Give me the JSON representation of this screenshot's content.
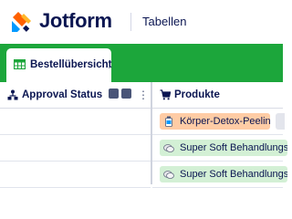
{
  "header": {
    "logo_text": "Jotform",
    "app_label": "Tabellen",
    "logo_colors": [
      "#ff6100",
      "#0099ff",
      "#ffb629",
      "#0a1551"
    ]
  },
  "tab": {
    "label": "Bestellübersicht",
    "more_icon": "⋮",
    "icon": "table-grid-icon",
    "color": "#1ca63b"
  },
  "columns": [
    {
      "label": "Approval Status",
      "icon": "approval-flow-icon"
    },
    {
      "label": "Produkte",
      "icon": "shopping-cart-icon"
    }
  ],
  "column_menu": "⋮",
  "rows": [
    {
      "approval_status": "",
      "product": "Körper-Detox-Peeling",
      "product_icon": "bottle-icon",
      "chip_color": "#ffcca5",
      "extra_chip": true
    },
    {
      "approval_status": "",
      "product": "Super Soft Behandlungs-Crème",
      "product_icon": "slippers-icon",
      "chip_color": "#d3f0d5",
      "extra_chip": false
    },
    {
      "approval_status": "",
      "product": "Super Soft Behandlungs-Crème",
      "product_icon": "slippers-icon",
      "chip_color": "#d3f0d5",
      "extra_chip": false
    }
  ]
}
